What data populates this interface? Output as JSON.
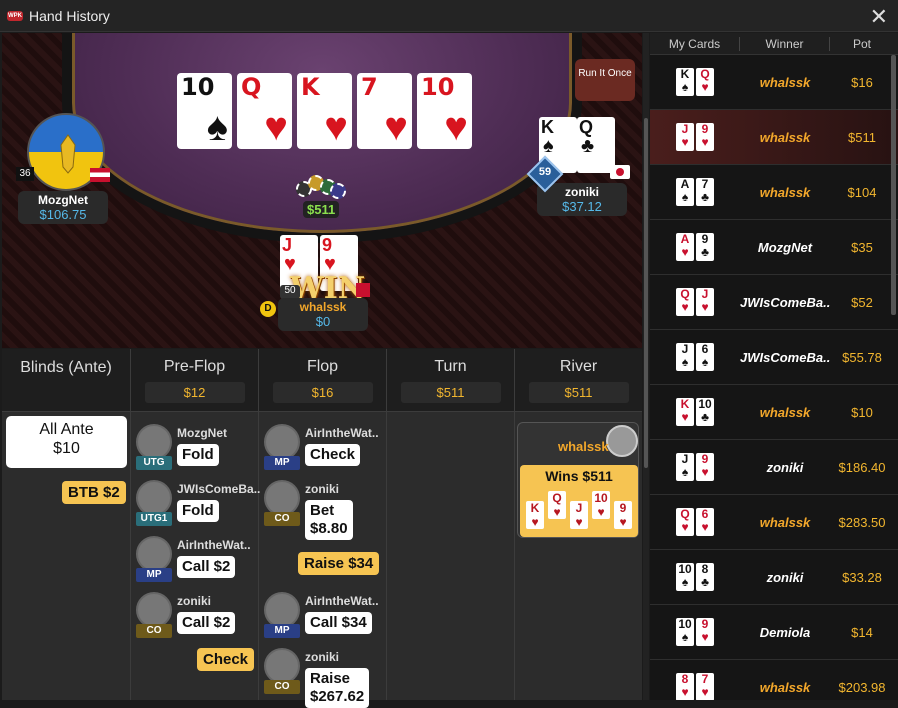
{
  "window": {
    "title": "Hand History",
    "logo_text": "WPK"
  },
  "table": {
    "run_it_once": "Run It Once",
    "board": [
      {
        "rank": "10",
        "suit": "♠",
        "red": false
      },
      {
        "rank": "Q",
        "suit": "♥",
        "red": true
      },
      {
        "rank": "K",
        "suit": "♥",
        "red": true
      },
      {
        "rank": "7",
        "suit": "♥",
        "red": true
      },
      {
        "rank": "10",
        "suit": "♥",
        "red": true
      }
    ],
    "pot": "$511",
    "win_text": "WIN",
    "players": {
      "left": {
        "name": "MozgNet",
        "stack": "$106.75",
        "level": "36"
      },
      "right": {
        "name": "zoniki",
        "stack": "$37.12",
        "level": "59",
        "cards": [
          {
            "rank": "K",
            "suit": "♠"
          },
          {
            "rank": "Q",
            "suit": "♣"
          }
        ]
      },
      "hero": {
        "name": "whalssk",
        "stack": "$0",
        "level": "50",
        "dealer": "D",
        "cards": [
          {
            "rank": "J",
            "suit": "♥"
          },
          {
            "rank": "9",
            "suit": "♥"
          }
        ]
      }
    }
  },
  "streets": {
    "blinds": {
      "label": "Blinds (Ante)",
      "ante_label": "All Ante",
      "ante_value": "$10",
      "btb": "BTB $2"
    },
    "preflop": {
      "label": "Pre-Flop",
      "pot": "$12"
    },
    "flop": {
      "label": "Flop",
      "pot": "$16"
    },
    "turn": {
      "label": "Turn",
      "pot": "$511"
    },
    "river": {
      "label": "River",
      "pot": "$511"
    }
  },
  "actions": {
    "preflop": [
      {
        "name": "MozgNet",
        "pos": "UTG",
        "action": "Fold"
      },
      {
        "name": "JWIsComeBa..",
        "pos": "UTG1",
        "action": "Fold"
      },
      {
        "name": "AirIntheWat..",
        "pos": "MP",
        "action": "Call $2"
      },
      {
        "name": "zoniki",
        "pos": "CO",
        "action": "Call $2"
      }
    ],
    "preflop_check": "Check",
    "flop": [
      {
        "name": "AirIntheWat..",
        "pos": "MP",
        "action": "Check"
      },
      {
        "name": "zoniki",
        "pos": "CO",
        "action": "Bet\n$8.80"
      },
      {
        "name": "AirIntheWat..",
        "pos": "MP",
        "action": "Call $34"
      },
      {
        "name": "zoniki",
        "pos": "CO",
        "action": "Raise\n$267.62"
      }
    ],
    "flop_raise": "Raise $34",
    "river_winner": {
      "name": "whalssk",
      "result": "Wins $511",
      "cards": [
        "K",
        "Q",
        "J",
        "10",
        "9"
      ]
    }
  },
  "history": {
    "headers": [
      "My Cards",
      "Winner",
      "Pot"
    ],
    "rows": [
      {
        "c1": "K",
        "s1": "♠",
        "c2": "Q",
        "s2": "♥",
        "winner": "whalssk",
        "pot": "$16",
        "mine": true
      },
      {
        "c1": "J",
        "s1": "♥",
        "c2": "9",
        "s2": "♥",
        "winner": "whalssk",
        "pot": "$511",
        "mine": true,
        "selected": true
      },
      {
        "c1": "A",
        "s1": "♠",
        "c2": "7",
        "s2": "♣",
        "winner": "whalssk",
        "pot": "$104",
        "mine": true
      },
      {
        "c1": "A",
        "s1": "♥",
        "c2": "9",
        "s2": "♣",
        "winner": "MozgNet",
        "pot": "$35",
        "mine": false
      },
      {
        "c1": "Q",
        "s1": "♥",
        "c2": "J",
        "s2": "♥",
        "winner": "JWIsComeBa..",
        "pot": "$52",
        "mine": false
      },
      {
        "c1": "J",
        "s1": "♠",
        "c2": "6",
        "s2": "♠",
        "winner": "JWIsComeBa..",
        "pot": "$55.78",
        "mine": false
      },
      {
        "c1": "K",
        "s1": "♥",
        "c2": "10",
        "s2": "♣",
        "winner": "whalssk",
        "pot": "$10",
        "mine": true
      },
      {
        "c1": "J",
        "s1": "♠",
        "c2": "9",
        "s2": "♥",
        "winner": "zoniki",
        "pot": "$186.40",
        "mine": false
      },
      {
        "c1": "Q",
        "s1": "♥",
        "c2": "6",
        "s2": "♥",
        "winner": "whalssk",
        "pot": "$283.50",
        "mine": true
      },
      {
        "c1": "10",
        "s1": "♠",
        "c2": "8",
        "s2": "♣",
        "winner": "zoniki",
        "pot": "$33.28",
        "mine": false
      },
      {
        "c1": "10",
        "s1": "♠",
        "c2": "9",
        "s2": "♥",
        "winner": "Demiola",
        "pot": "$14",
        "mine": false
      },
      {
        "c1": "8",
        "s1": "♥",
        "c2": "7",
        "s2": "♥",
        "winner": "whalssk",
        "pot": "$203.98",
        "mine": true
      }
    ]
  },
  "colors": {
    "accent_gold": "#f2b62f",
    "stack_blue": "#56b9e9",
    "pot_green": "#8be04e",
    "winner_orange": "#f2a72b"
  }
}
